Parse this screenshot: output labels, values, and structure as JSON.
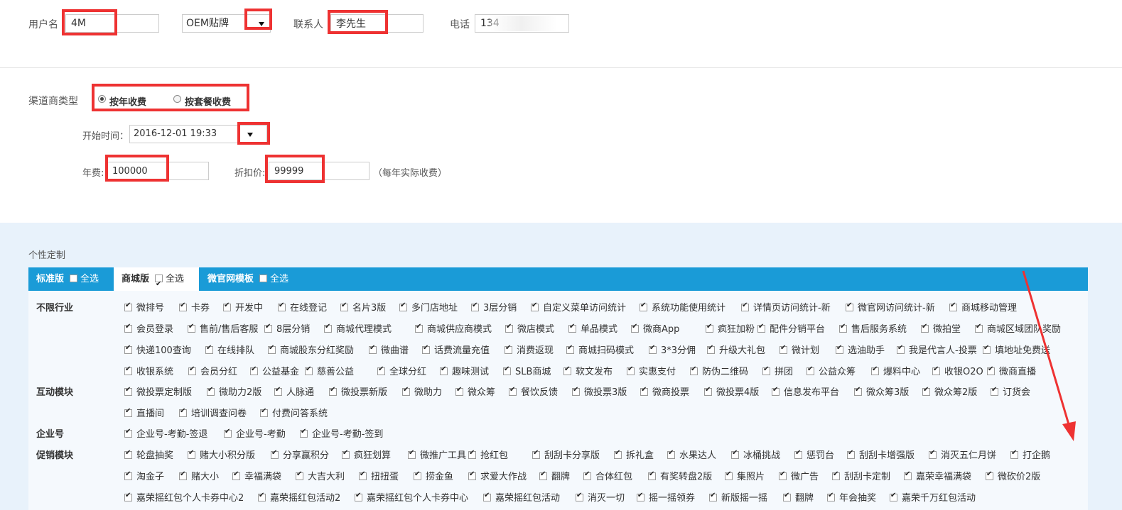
{
  "top": {
    "username_label": "用户名",
    "username_value": "4M",
    "type_value": "OEM贴牌",
    "contact_label": "联系人",
    "contact_value": "李先生",
    "phone_label": "电话",
    "phone_value": "134"
  },
  "channel": {
    "label": "渠道商类型",
    "option_year": "按年收费",
    "option_package": "按套餐收费",
    "start_label": "开始时间：",
    "start_value": "2016-12-01 19:33",
    "fee_label": "年费:",
    "fee_value": "100000",
    "discount_label": "折扣价:",
    "discount_value": "99999",
    "discount_note": "（每年实际收费）"
  },
  "custom": {
    "title": "个性定制",
    "tabs": [
      {
        "label": "标准版",
        "select_all": "全选",
        "checked": false
      },
      {
        "label": "商城版",
        "select_all": "全选",
        "checked": true
      },
      {
        "label": "微官网模板",
        "select_all": "全选",
        "checked": false
      }
    ],
    "categories": [
      {
        "name": "不限行业"
      },
      {
        "name": "互动模块"
      },
      {
        "name": "企业号"
      },
      {
        "name": "促销模块"
      }
    ],
    "rows": [
      [
        "微排号",
        "卡券",
        "开发中",
        "在线登记",
        "名片3版",
        "多门店地址",
        "3层分销",
        "自定义菜单访问统计",
        "系统功能使用统计",
        "详情页访问统计-新",
        "微官网访问统计-新",
        "商城移动管理"
      ],
      [
        "会员登录",
        "售前/售后客服",
        "8层分销",
        "商城代理模式",
        "商城供应商模式",
        "微店模式",
        "单品模式",
        "微商App",
        "疯狂加粉",
        "配件分销平台",
        "售后服务系统",
        "微拍堂",
        "商城区域团队奖励"
      ],
      [
        "快递100查询",
        "在线排队",
        "商城股东分红奖励",
        "微曲谱",
        "话费流量充值",
        "消费返现",
        "商城扫码模式",
        "3*3分佣",
        "升级大礼包",
        "微计划",
        "选油助手",
        "我是代言人-投票",
        "填地址免费送"
      ],
      [
        "收银系统",
        "会员分红",
        "公益基金",
        "慈善公益",
        "全球分红",
        "趣味测试",
        "SLB商城",
        "软文发布",
        "实惠支付",
        "防伪二维码",
        "拼团",
        "公益众筹",
        "爆料中心",
        "收银O2O",
        "微商直播"
      ],
      [
        "微投票定制版",
        "微助力2版",
        "人脉通",
        "微投票新版",
        "微助力",
        "微众筹",
        "餐饮反馈",
        "微投票3版",
        "微商投票",
        "微投票4版",
        "信息发布平台",
        "微众筹3版",
        "微众筹2版",
        "订货会"
      ],
      [
        "直播间",
        "培训调查问卷",
        "付费问答系统"
      ],
      [
        "企业号-考勤-签退",
        "企业号-考勤",
        "企业号-考勤-签到"
      ],
      [
        "轮盘抽奖",
        "赌大小积分版",
        "分享赢积分",
        "疯狂划算",
        "微推广工具",
        "抢红包",
        "刮刮卡分享版",
        "拆礼盒",
        "水果达人",
        "冰桶挑战",
        "惩罚台",
        "刮刮卡增强版",
        "消灭五仁月饼",
        "打企鹅"
      ],
      [
        "淘金子",
        "赌大小",
        "幸福满袋",
        "大吉大利",
        "扭扭蛋",
        "捞金鱼",
        "求爱大作战",
        "翻牌",
        "合体红包",
        "有奖转盘2版",
        "集照片",
        "微广告",
        "刮刮卡定制",
        "嘉荣幸福满袋",
        "微砍价2版"
      ],
      [
        "嘉荣摇红包个人卡券中心2",
        "嘉荣摇红包活动2",
        "嘉荣摇红包个人卡券中心",
        "嘉荣摇红包活动",
        "消灭一切",
        "摇一摇领券",
        "新版摇一摇",
        "翻牌",
        "年会抽奖",
        "嘉荣千万红包活动"
      ]
    ]
  },
  "colors": {
    "accent": "#1a9bd7",
    "annotation": "#ee3232"
  }
}
